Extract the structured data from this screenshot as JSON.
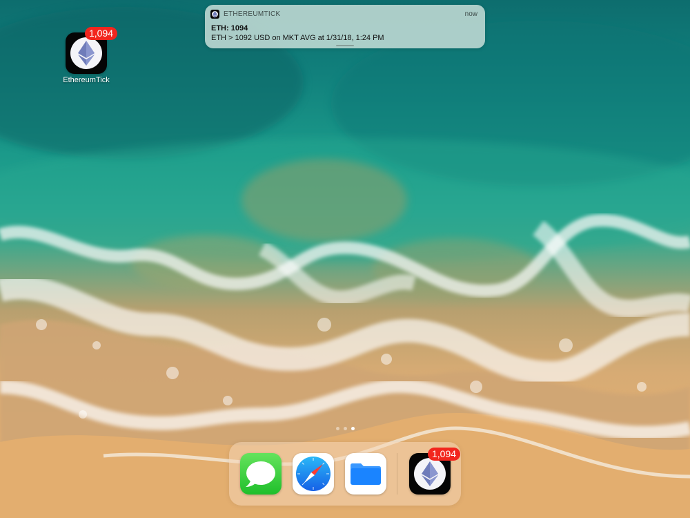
{
  "notification": {
    "app_name": "ETHEREUMTICK",
    "time": "now",
    "title": "ETH: 1094",
    "body": "ETH > 1092 USD on MKT AVG at 1/31/18, 1:24 PM"
  },
  "home_screen": {
    "apps": [
      {
        "label": "EthereumTick",
        "badge": "1,094",
        "icon": "ethereum-icon"
      }
    ],
    "page_count": 3,
    "current_page": 3
  },
  "dock": {
    "apps": [
      {
        "name": "Messages",
        "icon": "messages-icon"
      },
      {
        "name": "Safari",
        "icon": "safari-icon"
      },
      {
        "name": "Files",
        "icon": "files-icon"
      },
      {
        "name": "EthereumTick",
        "icon": "ethereum-icon",
        "badge": "1,094"
      }
    ]
  },
  "colors": {
    "badge": "#f2261e",
    "ethereum_logo": "#6f7cba",
    "messages_green": "#32c93c",
    "safari_blue": "#1a86f2",
    "files_blue": "#1a84ff"
  }
}
